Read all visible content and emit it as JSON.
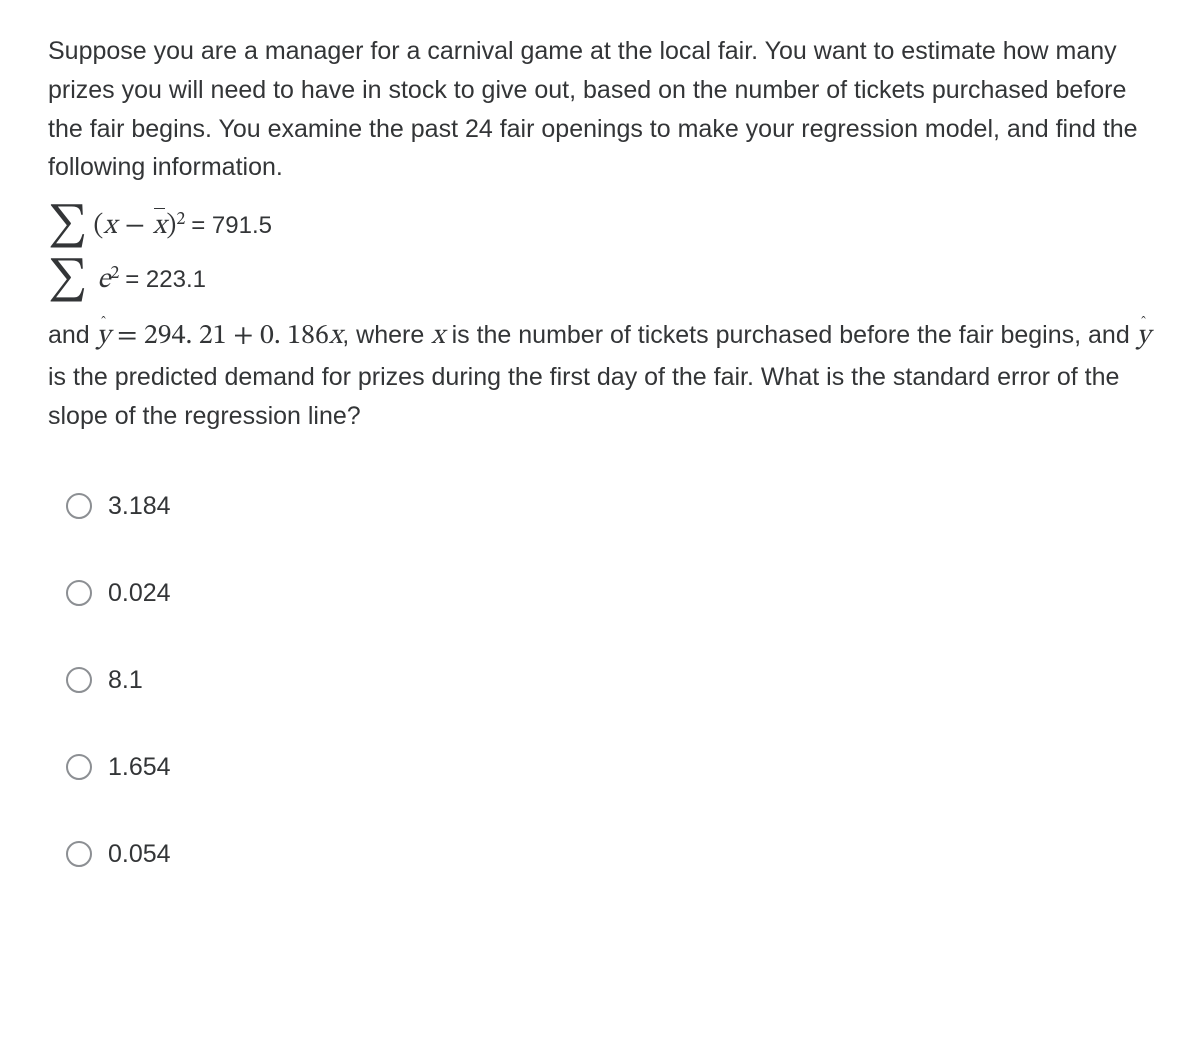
{
  "question": {
    "intro": "Suppose you are a manager for a carnival game at the local fair. You want to estimate how many prizes you will need to have in stock to give out, based on the number of tickets purchased before the fair begins. You examine the past 24 fair openings to make your regression model, and find the following information.",
    "sum_sq_x_value": "= 791.5",
    "sum_sq_e_value": "= 223.1",
    "body_prefix": "and ",
    "regression_eq": " = 294. 21 + 0. 186",
    "body_middle": ", where ",
    "body_mid2": " is the number of tickets purchased before the fair begins, and ",
    "body_suffix": " is the predicted demand for prizes during the first day of the fair. What is the standard error of the slope of the regression line?"
  },
  "options": [
    {
      "label": "3.184"
    },
    {
      "label": "0.024"
    },
    {
      "label": "8.1"
    },
    {
      "label": "1.654"
    },
    {
      "label": "0.054"
    }
  ]
}
